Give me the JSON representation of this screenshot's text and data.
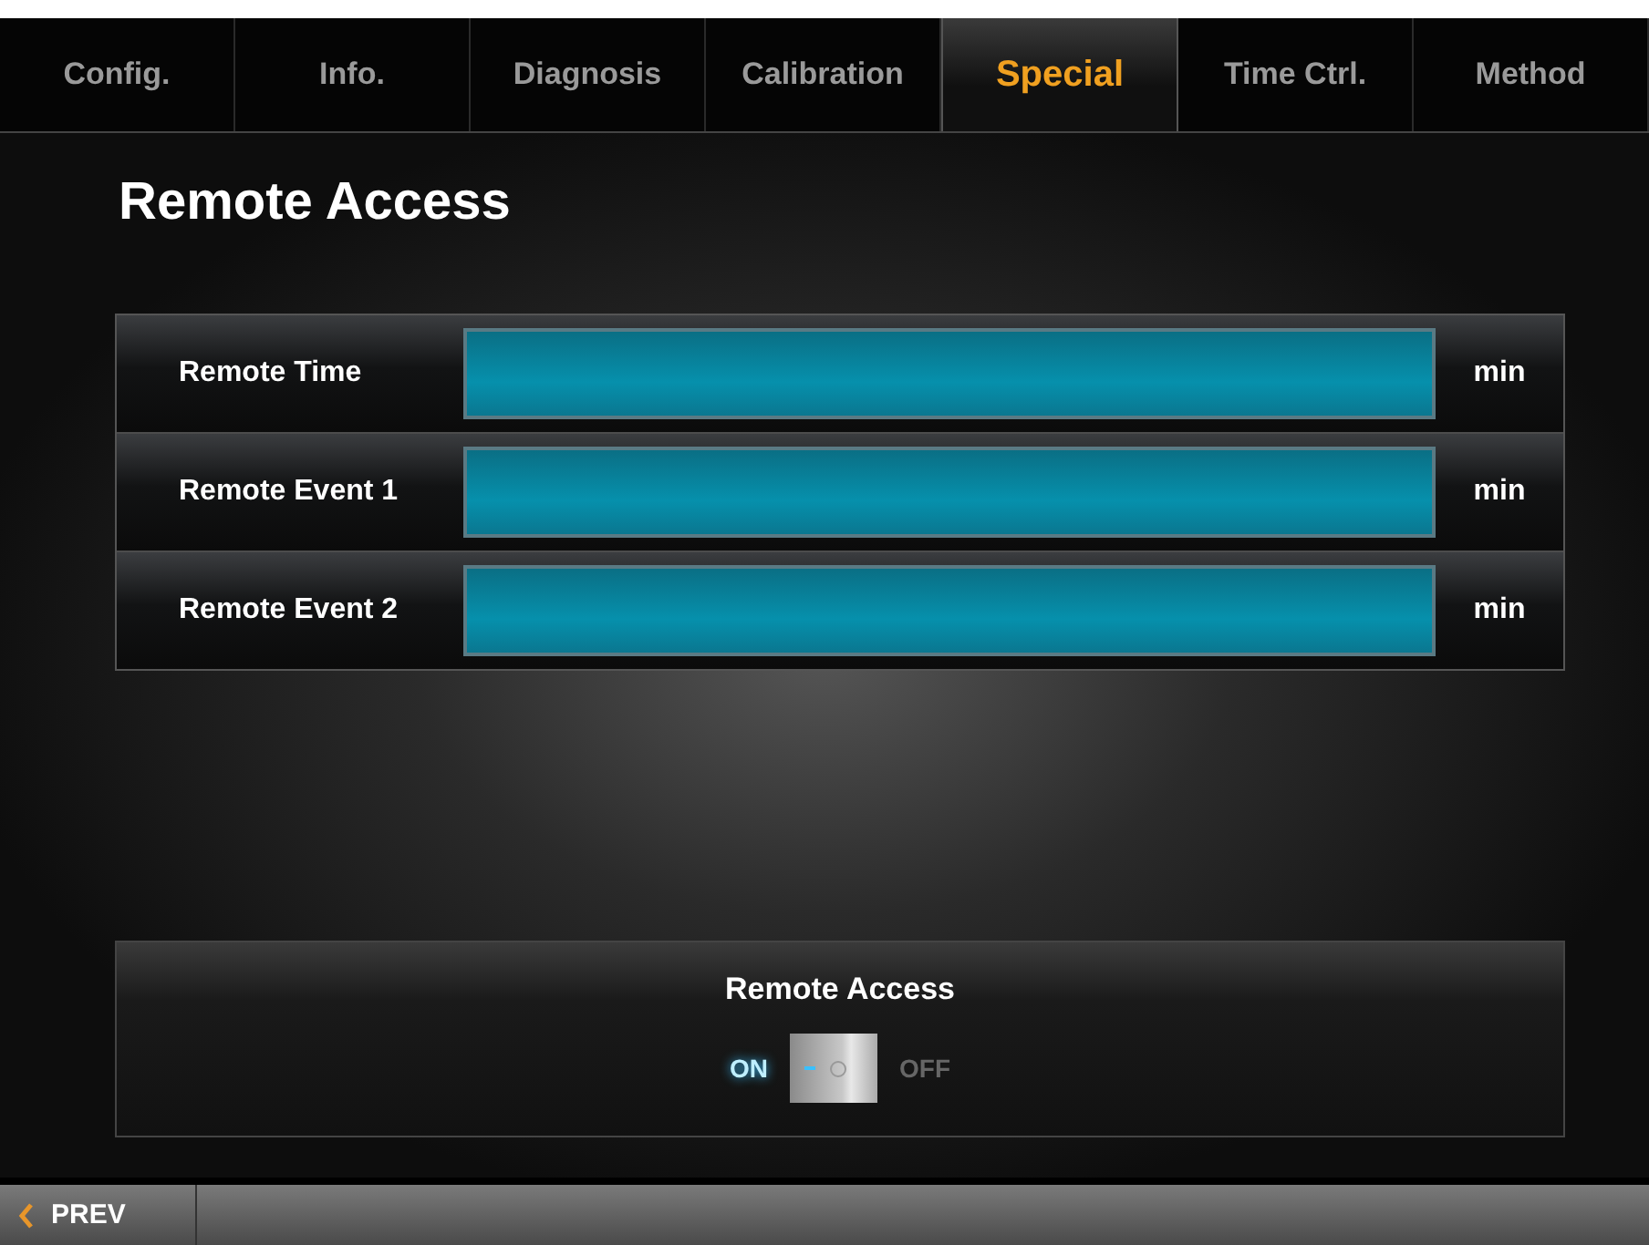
{
  "tabs": [
    {
      "label": "Config.",
      "selected": false
    },
    {
      "label": "Info.",
      "selected": false
    },
    {
      "label": "Diagnosis",
      "selected": false
    },
    {
      "label": "Calibration",
      "selected": false
    },
    {
      "label": "Special",
      "selected": true
    },
    {
      "label": "Time Ctrl.",
      "selected": false
    },
    {
      "label": "Method",
      "selected": false
    }
  ],
  "title": "Remote Access",
  "fields": [
    {
      "label": "Remote Time",
      "unit": "min"
    },
    {
      "label": "Remote Event 1",
      "unit": "min"
    },
    {
      "label": "Remote Event 2",
      "unit": "min"
    }
  ],
  "switch_panel": {
    "title": "Remote Access",
    "on_label": "ON",
    "off_label": "OFF",
    "on": true
  },
  "footer": {
    "prev_button": "PREV"
  }
}
